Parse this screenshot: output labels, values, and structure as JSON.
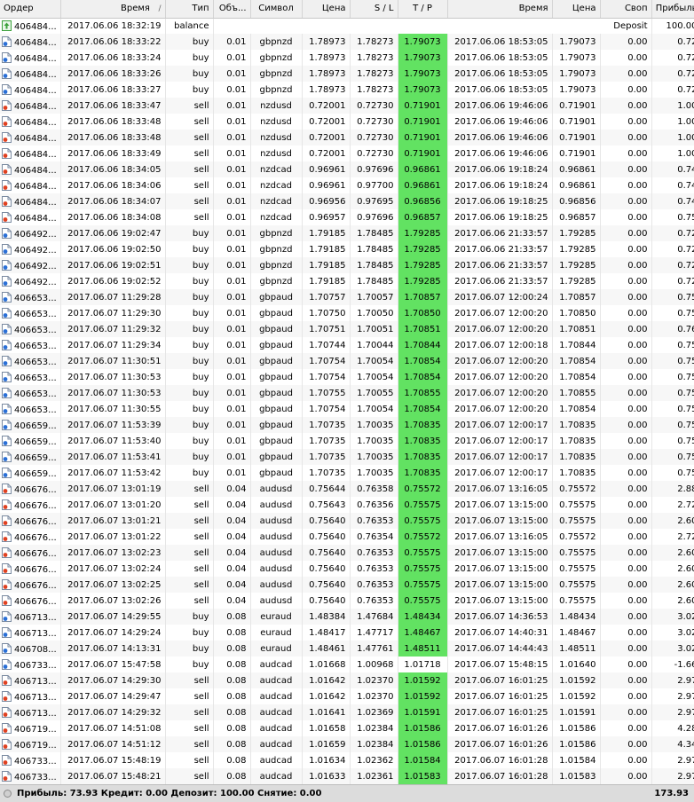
{
  "columns": {
    "order": "Ордер",
    "time": "Время",
    "time_sort": "/",
    "type": "Тип",
    "volume": "Объ...",
    "symbol": "Символ",
    "price": "Цена",
    "sl": "S / L",
    "tp": "T / P",
    "close_time": "Время",
    "close_price": "Цена",
    "swap": "Своп",
    "profit": "Прибыль"
  },
  "balance_row": {
    "order": "406484...",
    "time": "2017.06.06 18:32:19",
    "type": "balance",
    "comment": "Deposit",
    "profit": "100.00"
  },
  "trades": [
    {
      "order": "406484...",
      "time": "2017.06.06 18:33:22",
      "type": "buy",
      "volume": "0.01",
      "symbol": "gbpnzd",
      "price": "1.78973",
      "sl": "1.78273",
      "tp": "1.79073",
      "tp_hl": true,
      "close_time": "2017.06.06 18:53:05",
      "close_price": "1.79073",
      "swap": "0.00",
      "profit": "0.72"
    },
    {
      "order": "406484...",
      "time": "2017.06.06 18:33:24",
      "type": "buy",
      "volume": "0.01",
      "symbol": "gbpnzd",
      "price": "1.78973",
      "sl": "1.78273",
      "tp": "1.79073",
      "tp_hl": true,
      "close_time": "2017.06.06 18:53:05",
      "close_price": "1.79073",
      "swap": "0.00",
      "profit": "0.72"
    },
    {
      "order": "406484...",
      "time": "2017.06.06 18:33:26",
      "type": "buy",
      "volume": "0.01",
      "symbol": "gbpnzd",
      "price": "1.78973",
      "sl": "1.78273",
      "tp": "1.79073",
      "tp_hl": true,
      "close_time": "2017.06.06 18:53:05",
      "close_price": "1.79073",
      "swap": "0.00",
      "profit": "0.72"
    },
    {
      "order": "406484...",
      "time": "2017.06.06 18:33:27",
      "type": "buy",
      "volume": "0.01",
      "symbol": "gbpnzd",
      "price": "1.78973",
      "sl": "1.78273",
      "tp": "1.79073",
      "tp_hl": true,
      "close_time": "2017.06.06 18:53:05",
      "close_price": "1.79073",
      "swap": "0.00",
      "profit": "0.72"
    },
    {
      "order": "406484...",
      "time": "2017.06.06 18:33:47",
      "type": "sell",
      "volume": "0.01",
      "symbol": "nzdusd",
      "price": "0.72001",
      "sl": "0.72730",
      "tp": "0.71901",
      "tp_hl": true,
      "close_time": "2017.06.06 19:46:06",
      "close_price": "0.71901",
      "swap": "0.00",
      "profit": "1.00"
    },
    {
      "order": "406484...",
      "time": "2017.06.06 18:33:48",
      "type": "sell",
      "volume": "0.01",
      "symbol": "nzdusd",
      "price": "0.72001",
      "sl": "0.72730",
      "tp": "0.71901",
      "tp_hl": true,
      "close_time": "2017.06.06 19:46:06",
      "close_price": "0.71901",
      "swap": "0.00",
      "profit": "1.00"
    },
    {
      "order": "406484...",
      "time": "2017.06.06 18:33:48",
      "type": "sell",
      "volume": "0.01",
      "symbol": "nzdusd",
      "price": "0.72001",
      "sl": "0.72730",
      "tp": "0.71901",
      "tp_hl": true,
      "close_time": "2017.06.06 19:46:06",
      "close_price": "0.71901",
      "swap": "0.00",
      "profit": "1.00"
    },
    {
      "order": "406484...",
      "time": "2017.06.06 18:33:49",
      "type": "sell",
      "volume": "0.01",
      "symbol": "nzdusd",
      "price": "0.72001",
      "sl": "0.72730",
      "tp": "0.71901",
      "tp_hl": true,
      "close_time": "2017.06.06 19:46:06",
      "close_price": "0.71901",
      "swap": "0.00",
      "profit": "1.00"
    },
    {
      "order": "406484...",
      "time": "2017.06.06 18:34:05",
      "type": "sell",
      "volume": "0.01",
      "symbol": "nzdcad",
      "price": "0.96961",
      "sl": "0.97696",
      "tp": "0.96861",
      "tp_hl": true,
      "close_time": "2017.06.06 19:18:24",
      "close_price": "0.96861",
      "swap": "0.00",
      "profit": "0.74"
    },
    {
      "order": "406484...",
      "time": "2017.06.06 18:34:06",
      "type": "sell",
      "volume": "0.01",
      "symbol": "nzdcad",
      "price": "0.96961",
      "sl": "0.97700",
      "tp": "0.96861",
      "tp_hl": true,
      "close_time": "2017.06.06 19:18:24",
      "close_price": "0.96861",
      "swap": "0.00",
      "profit": "0.74"
    },
    {
      "order": "406484...",
      "time": "2017.06.06 18:34:07",
      "type": "sell",
      "volume": "0.01",
      "symbol": "nzdcad",
      "price": "0.96956",
      "sl": "0.97695",
      "tp": "0.96856",
      "tp_hl": true,
      "close_time": "2017.06.06 19:18:25",
      "close_price": "0.96856",
      "swap": "0.00",
      "profit": "0.74"
    },
    {
      "order": "406484...",
      "time": "2017.06.06 18:34:08",
      "type": "sell",
      "volume": "0.01",
      "symbol": "nzdcad",
      "price": "0.96957",
      "sl": "0.97696",
      "tp": "0.96857",
      "tp_hl": true,
      "close_time": "2017.06.06 19:18:25",
      "close_price": "0.96857",
      "swap": "0.00",
      "profit": "0.75"
    },
    {
      "order": "406492...",
      "time": "2017.06.06 19:02:47",
      "type": "buy",
      "volume": "0.01",
      "symbol": "gbpnzd",
      "price": "1.79185",
      "sl": "1.78485",
      "tp": "1.79285",
      "tp_hl": true,
      "close_time": "2017.06.06 21:33:57",
      "close_price": "1.79285",
      "swap": "0.00",
      "profit": "0.72"
    },
    {
      "order": "406492...",
      "time": "2017.06.06 19:02:50",
      "type": "buy",
      "volume": "0.01",
      "symbol": "gbpnzd",
      "price": "1.79185",
      "sl": "1.78485",
      "tp": "1.79285",
      "tp_hl": true,
      "close_time": "2017.06.06 21:33:57",
      "close_price": "1.79285",
      "swap": "0.00",
      "profit": "0.72"
    },
    {
      "order": "406492...",
      "time": "2017.06.06 19:02:51",
      "type": "buy",
      "volume": "0.01",
      "symbol": "gbpnzd",
      "price": "1.79185",
      "sl": "1.78485",
      "tp": "1.79285",
      "tp_hl": true,
      "close_time": "2017.06.06 21:33:57",
      "close_price": "1.79285",
      "swap": "0.00",
      "profit": "0.72"
    },
    {
      "order": "406492...",
      "time": "2017.06.06 19:02:52",
      "type": "buy",
      "volume": "0.01",
      "symbol": "gbpnzd",
      "price": "1.79185",
      "sl": "1.78485",
      "tp": "1.79285",
      "tp_hl": true,
      "close_time": "2017.06.06 21:33:57",
      "close_price": "1.79285",
      "swap": "0.00",
      "profit": "0.72"
    },
    {
      "order": "406653...",
      "time": "2017.06.07 11:29:28",
      "type": "buy",
      "volume": "0.01",
      "symbol": "gbpaud",
      "price": "1.70757",
      "sl": "1.70057",
      "tp": "1.70857",
      "tp_hl": true,
      "close_time": "2017.06.07 12:00:24",
      "close_price": "1.70857",
      "swap": "0.00",
      "profit": "0.75"
    },
    {
      "order": "406653...",
      "time": "2017.06.07 11:29:30",
      "type": "buy",
      "volume": "0.01",
      "symbol": "gbpaud",
      "price": "1.70750",
      "sl": "1.70050",
      "tp": "1.70850",
      "tp_hl": true,
      "close_time": "2017.06.07 12:00:20",
      "close_price": "1.70850",
      "swap": "0.00",
      "profit": "0.75"
    },
    {
      "order": "406653...",
      "time": "2017.06.07 11:29:32",
      "type": "buy",
      "volume": "0.01",
      "symbol": "gbpaud",
      "price": "1.70751",
      "sl": "1.70051",
      "tp": "1.70851",
      "tp_hl": true,
      "close_time": "2017.06.07 12:00:20",
      "close_price": "1.70851",
      "swap": "0.00",
      "profit": "0.76"
    },
    {
      "order": "406653...",
      "time": "2017.06.07 11:29:34",
      "type": "buy",
      "volume": "0.01",
      "symbol": "gbpaud",
      "price": "1.70744",
      "sl": "1.70044",
      "tp": "1.70844",
      "tp_hl": true,
      "close_time": "2017.06.07 12:00:18",
      "close_price": "1.70844",
      "swap": "0.00",
      "profit": "0.75"
    },
    {
      "order": "406653...",
      "time": "2017.06.07 11:30:51",
      "type": "buy",
      "volume": "0.01",
      "symbol": "gbpaud",
      "price": "1.70754",
      "sl": "1.70054",
      "tp": "1.70854",
      "tp_hl": true,
      "close_time": "2017.06.07 12:00:20",
      "close_price": "1.70854",
      "swap": "0.00",
      "profit": "0.75"
    },
    {
      "order": "406653...",
      "time": "2017.06.07 11:30:53",
      "type": "buy",
      "volume": "0.01",
      "symbol": "gbpaud",
      "price": "1.70754",
      "sl": "1.70054",
      "tp": "1.70854",
      "tp_hl": true,
      "close_time": "2017.06.07 12:00:20",
      "close_price": "1.70854",
      "swap": "0.00",
      "profit": "0.75"
    },
    {
      "order": "406653...",
      "time": "2017.06.07 11:30:53",
      "type": "buy",
      "volume": "0.01",
      "symbol": "gbpaud",
      "price": "1.70755",
      "sl": "1.70055",
      "tp": "1.70855",
      "tp_hl": true,
      "close_time": "2017.06.07 12:00:20",
      "close_price": "1.70855",
      "swap": "0.00",
      "profit": "0.75"
    },
    {
      "order": "406653...",
      "time": "2017.06.07 11:30:55",
      "type": "buy",
      "volume": "0.01",
      "symbol": "gbpaud",
      "price": "1.70754",
      "sl": "1.70054",
      "tp": "1.70854",
      "tp_hl": true,
      "close_time": "2017.06.07 12:00:20",
      "close_price": "1.70854",
      "swap": "0.00",
      "profit": "0.75"
    },
    {
      "order": "406659...",
      "time": "2017.06.07 11:53:39",
      "type": "buy",
      "volume": "0.01",
      "symbol": "gbpaud",
      "price": "1.70735",
      "sl": "1.70035",
      "tp": "1.70835",
      "tp_hl": true,
      "close_time": "2017.06.07 12:00:17",
      "close_price": "1.70835",
      "swap": "0.00",
      "profit": "0.75"
    },
    {
      "order": "406659...",
      "time": "2017.06.07 11:53:40",
      "type": "buy",
      "volume": "0.01",
      "symbol": "gbpaud",
      "price": "1.70735",
      "sl": "1.70035",
      "tp": "1.70835",
      "tp_hl": true,
      "close_time": "2017.06.07 12:00:17",
      "close_price": "1.70835",
      "swap": "0.00",
      "profit": "0.75"
    },
    {
      "order": "406659...",
      "time": "2017.06.07 11:53:41",
      "type": "buy",
      "volume": "0.01",
      "symbol": "gbpaud",
      "price": "1.70735",
      "sl": "1.70035",
      "tp": "1.70835",
      "tp_hl": true,
      "close_time": "2017.06.07 12:00:17",
      "close_price": "1.70835",
      "swap": "0.00",
      "profit": "0.75"
    },
    {
      "order": "406659...",
      "time": "2017.06.07 11:53:42",
      "type": "buy",
      "volume": "0.01",
      "symbol": "gbpaud",
      "price": "1.70735",
      "sl": "1.70035",
      "tp": "1.70835",
      "tp_hl": true,
      "close_time": "2017.06.07 12:00:17",
      "close_price": "1.70835",
      "swap": "0.00",
      "profit": "0.75"
    },
    {
      "order": "406676...",
      "time": "2017.06.07 13:01:19",
      "type": "sell",
      "volume": "0.04",
      "symbol": "audusd",
      "price": "0.75644",
      "sl": "0.76358",
      "tp": "0.75572",
      "tp_hl": true,
      "close_time": "2017.06.07 13:16:05",
      "close_price": "0.75572",
      "swap": "0.00",
      "profit": "2.88"
    },
    {
      "order": "406676...",
      "time": "2017.06.07 13:01:20",
      "type": "sell",
      "volume": "0.04",
      "symbol": "audusd",
      "price": "0.75643",
      "sl": "0.76356",
      "tp": "0.75575",
      "tp_hl": true,
      "close_time": "2017.06.07 13:15:00",
      "close_price": "0.75575",
      "swap": "0.00",
      "profit": "2.72"
    },
    {
      "order": "406676...",
      "time": "2017.06.07 13:01:21",
      "type": "sell",
      "volume": "0.04",
      "symbol": "audusd",
      "price": "0.75640",
      "sl": "0.76353",
      "tp": "0.75575",
      "tp_hl": true,
      "close_time": "2017.06.07 13:15:00",
      "close_price": "0.75575",
      "swap": "0.00",
      "profit": "2.60"
    },
    {
      "order": "406676...",
      "time": "2017.06.07 13:01:22",
      "type": "sell",
      "volume": "0.04",
      "symbol": "audusd",
      "price": "0.75640",
      "sl": "0.76354",
      "tp": "0.75572",
      "tp_hl": true,
      "close_time": "2017.06.07 13:16:05",
      "close_price": "0.75572",
      "swap": "0.00",
      "profit": "2.72"
    },
    {
      "order": "406676...",
      "time": "2017.06.07 13:02:23",
      "type": "sell",
      "volume": "0.04",
      "symbol": "audusd",
      "price": "0.75640",
      "sl": "0.76353",
      "tp": "0.75575",
      "tp_hl": true,
      "close_time": "2017.06.07 13:15:00",
      "close_price": "0.75575",
      "swap": "0.00",
      "profit": "2.60"
    },
    {
      "order": "406676...",
      "time": "2017.06.07 13:02:24",
      "type": "sell",
      "volume": "0.04",
      "symbol": "audusd",
      "price": "0.75640",
      "sl": "0.76353",
      "tp": "0.75575",
      "tp_hl": true,
      "close_time": "2017.06.07 13:15:00",
      "close_price": "0.75575",
      "swap": "0.00",
      "profit": "2.60"
    },
    {
      "order": "406676...",
      "time": "2017.06.07 13:02:25",
      "type": "sell",
      "volume": "0.04",
      "symbol": "audusd",
      "price": "0.75640",
      "sl": "0.76353",
      "tp": "0.75575",
      "tp_hl": true,
      "close_time": "2017.06.07 13:15:00",
      "close_price": "0.75575",
      "swap": "0.00",
      "profit": "2.60"
    },
    {
      "order": "406676...",
      "time": "2017.06.07 13:02:26",
      "type": "sell",
      "volume": "0.04",
      "symbol": "audusd",
      "price": "0.75640",
      "sl": "0.76353",
      "tp": "0.75575",
      "tp_hl": true,
      "close_time": "2017.06.07 13:15:00",
      "close_price": "0.75575",
      "swap": "0.00",
      "profit": "2.60"
    },
    {
      "order": "406713...",
      "time": "2017.06.07 14:29:55",
      "type": "buy",
      "volume": "0.08",
      "symbol": "euraud",
      "price": "1.48384",
      "sl": "1.47684",
      "tp": "1.48434",
      "tp_hl": true,
      "close_time": "2017.06.07 14:36:53",
      "close_price": "1.48434",
      "swap": "0.00",
      "profit": "3.02"
    },
    {
      "order": "406713...",
      "time": "2017.06.07 14:29:24",
      "type": "buy",
      "volume": "0.08",
      "symbol": "euraud",
      "price": "1.48417",
      "sl": "1.47717",
      "tp": "1.48467",
      "tp_hl": true,
      "close_time": "2017.06.07 14:40:31",
      "close_price": "1.48467",
      "swap": "0.00",
      "profit": "3.02"
    },
    {
      "order": "406708...",
      "time": "2017.06.07 14:13:31",
      "type": "buy",
      "volume": "0.08",
      "symbol": "euraud",
      "price": "1.48461",
      "sl": "1.47761",
      "tp": "1.48511",
      "tp_hl": true,
      "close_time": "2017.06.07 14:44:43",
      "close_price": "1.48511",
      "swap": "0.00",
      "profit": "3.02"
    },
    {
      "order": "406733...",
      "time": "2017.06.07 15:47:58",
      "type": "buy",
      "volume": "0.08",
      "symbol": "audcad",
      "price": "1.01668",
      "sl": "1.00968",
      "tp": "1.01718",
      "tp_hl": false,
      "close_time": "2017.06.07 15:48:15",
      "close_price": "1.01640",
      "swap": "0.00",
      "profit": "-1.66"
    },
    {
      "order": "406713...",
      "time": "2017.06.07 14:29:30",
      "type": "sell",
      "volume": "0.08",
      "symbol": "audcad",
      "price": "1.01642",
      "sl": "1.02370",
      "tp": "1.01592",
      "tp_hl": true,
      "close_time": "2017.06.07 16:01:25",
      "close_price": "1.01592",
      "swap": "0.00",
      "profit": "2.97"
    },
    {
      "order": "406713...",
      "time": "2017.06.07 14:29:47",
      "type": "sell",
      "volume": "0.08",
      "symbol": "audcad",
      "price": "1.01642",
      "sl": "1.02370",
      "tp": "1.01592",
      "tp_hl": true,
      "close_time": "2017.06.07 16:01:25",
      "close_price": "1.01592",
      "swap": "0.00",
      "profit": "2.97"
    },
    {
      "order": "406713...",
      "time": "2017.06.07 14:29:32",
      "type": "sell",
      "volume": "0.08",
      "symbol": "audcad",
      "price": "1.01641",
      "sl": "1.02369",
      "tp": "1.01591",
      "tp_hl": true,
      "close_time": "2017.06.07 16:01:25",
      "close_price": "1.01591",
      "swap": "0.00",
      "profit": "2.97"
    },
    {
      "order": "406719...",
      "time": "2017.06.07 14:51:08",
      "type": "sell",
      "volume": "0.08",
      "symbol": "audcad",
      "price": "1.01658",
      "sl": "1.02384",
      "tp": "1.01586",
      "tp_hl": true,
      "close_time": "2017.06.07 16:01:26",
      "close_price": "1.01586",
      "swap": "0.00",
      "profit": "4.28"
    },
    {
      "order": "406719...",
      "time": "2017.06.07 14:51:12",
      "type": "sell",
      "volume": "0.08",
      "symbol": "audcad",
      "price": "1.01659",
      "sl": "1.02384",
      "tp": "1.01586",
      "tp_hl": true,
      "close_time": "2017.06.07 16:01:26",
      "close_price": "1.01586",
      "swap": "0.00",
      "profit": "4.34"
    },
    {
      "order": "406733...",
      "time": "2017.06.07 15:48:19",
      "type": "sell",
      "volume": "0.08",
      "symbol": "audcad",
      "price": "1.01634",
      "sl": "1.02362",
      "tp": "1.01584",
      "tp_hl": true,
      "close_time": "2017.06.07 16:01:28",
      "close_price": "1.01584",
      "swap": "0.00",
      "profit": "2.97"
    },
    {
      "order": "406733...",
      "time": "2017.06.07 15:48:21",
      "type": "sell",
      "volume": "0.08",
      "symbol": "audcad",
      "price": "1.01633",
      "sl": "1.02361",
      "tp": "1.01583",
      "tp_hl": true,
      "close_time": "2017.06.07 16:01:28",
      "close_price": "1.01583",
      "swap": "0.00",
      "profit": "2.97"
    }
  ],
  "footer": {
    "summary": "Прибыль: 73.93  Кредит: 0.00  Депозит: 100.00  Снятие: 0.00",
    "total": "173.93"
  },
  "colors": {
    "tp_highlight": "#62e262",
    "buy_icon": "#2a6fd6",
    "sell_icon": "#e04020",
    "balance_icon": "#3aa03a"
  },
  "icons": {
    "balance": "balance-icon",
    "buy": "buy-order-icon",
    "sell": "sell-order-icon",
    "footer": "status-dot-icon"
  }
}
